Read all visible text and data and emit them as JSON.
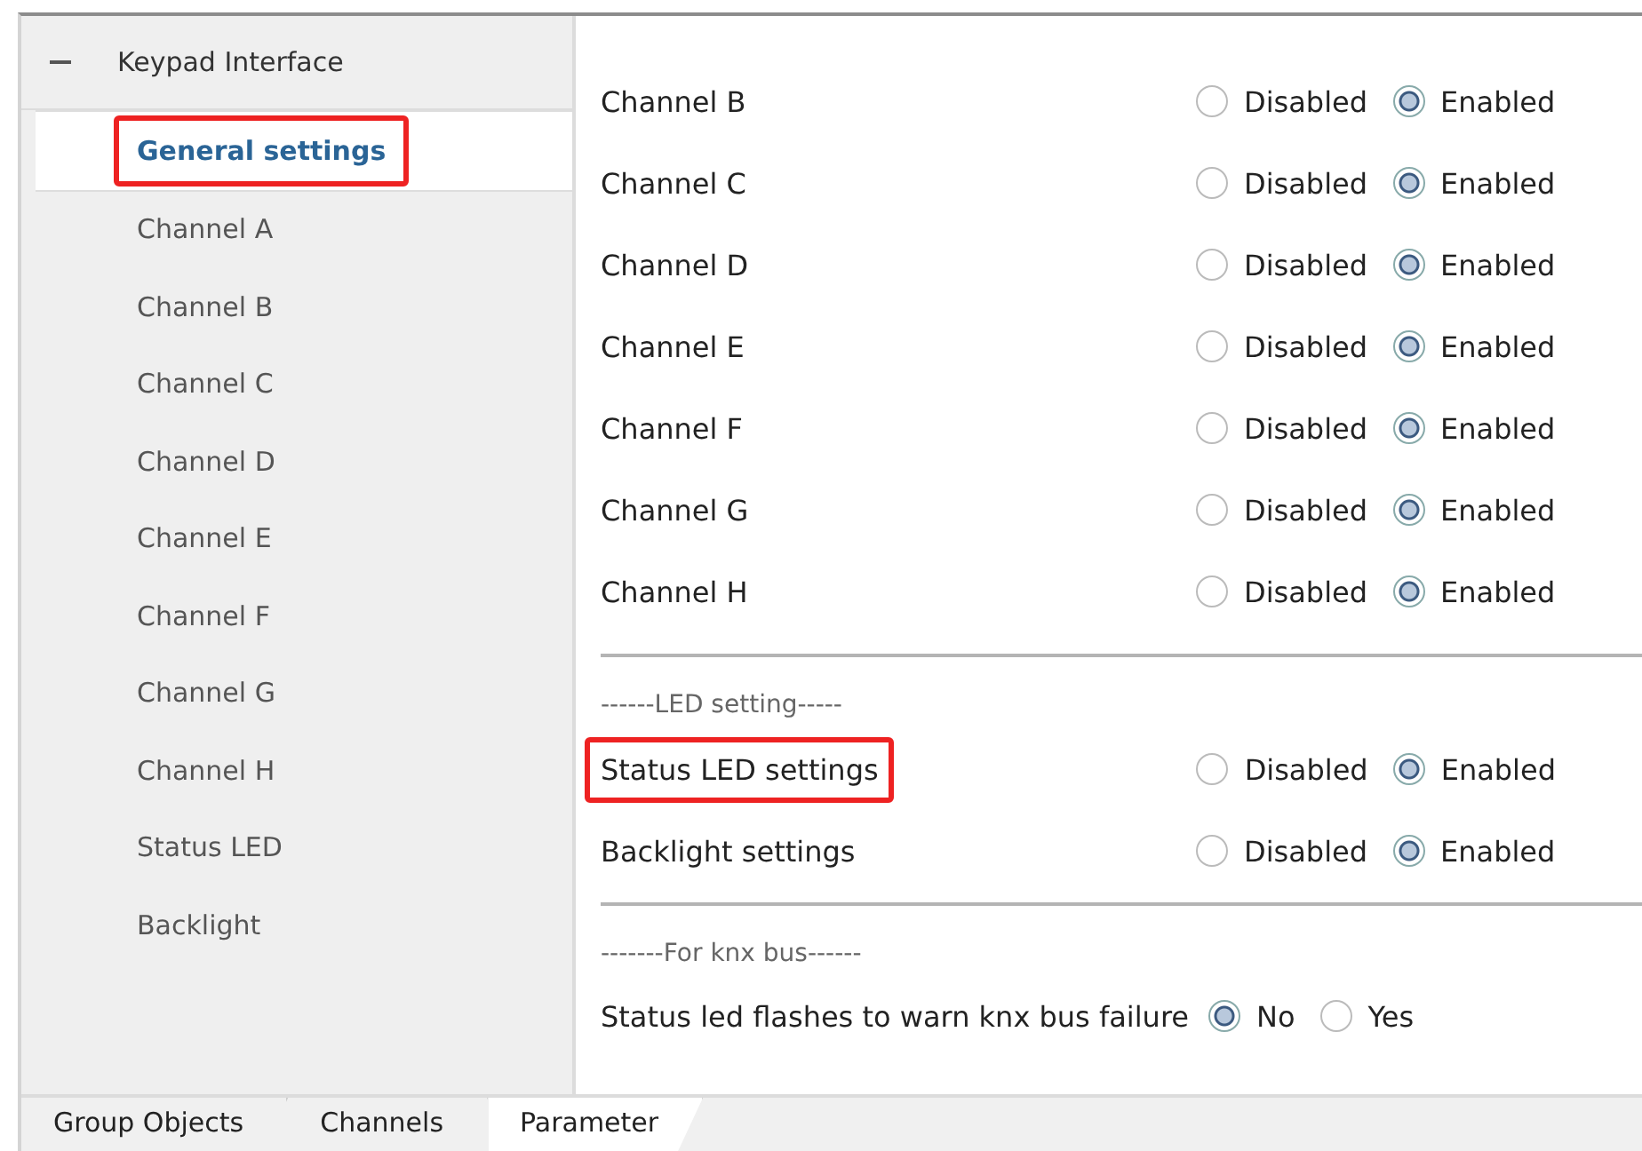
{
  "tree": {
    "title": "Keypad Interface",
    "expanded": true,
    "items": [
      {
        "label": "General settings",
        "selected": true,
        "highlighted": true
      },
      {
        "label": "Channel A",
        "selected": false,
        "highlighted": false
      },
      {
        "label": "Channel B",
        "selected": false,
        "highlighted": false
      },
      {
        "label": "Channel C",
        "selected": false,
        "highlighted": false
      },
      {
        "label": "Channel D",
        "selected": false,
        "highlighted": false
      },
      {
        "label": "Channel E",
        "selected": false,
        "highlighted": false
      },
      {
        "label": "Channel F",
        "selected": false,
        "highlighted": false
      },
      {
        "label": "Channel G",
        "selected": false,
        "highlighted": false
      },
      {
        "label": "Channel H",
        "selected": false,
        "highlighted": false
      },
      {
        "label": "Status LED",
        "selected": false,
        "highlighted": false
      },
      {
        "label": "Backlight",
        "selected": false,
        "highlighted": false
      }
    ]
  },
  "sections": [
    {
      "rows": [
        {
          "label": "Channel B",
          "highlighted": false,
          "options": [
            {
              "label": "Disabled",
              "selected": false
            },
            {
              "label": "Enabled",
              "selected": true
            }
          ]
        },
        {
          "label": "Channel C",
          "highlighted": false,
          "options": [
            {
              "label": "Disabled",
              "selected": false
            },
            {
              "label": "Enabled",
              "selected": true
            }
          ]
        },
        {
          "label": "Channel D",
          "highlighted": false,
          "options": [
            {
              "label": "Disabled",
              "selected": false
            },
            {
              "label": "Enabled",
              "selected": true
            }
          ]
        },
        {
          "label": "Channel E",
          "highlighted": false,
          "options": [
            {
              "label": "Disabled",
              "selected": false
            },
            {
              "label": "Enabled",
              "selected": true
            }
          ]
        },
        {
          "label": "Channel F",
          "highlighted": false,
          "options": [
            {
              "label": "Disabled",
              "selected": false
            },
            {
              "label": "Enabled",
              "selected": true
            }
          ]
        },
        {
          "label": "Channel G",
          "highlighted": false,
          "options": [
            {
              "label": "Disabled",
              "selected": false
            },
            {
              "label": "Enabled",
              "selected": true
            }
          ]
        },
        {
          "label": "Channel H",
          "highlighted": false,
          "options": [
            {
              "label": "Disabled",
              "selected": false
            },
            {
              "label": "Enabled",
              "selected": true
            }
          ]
        }
      ]
    },
    {
      "heading": "------LED setting-----",
      "rows": [
        {
          "label": "Status LED settings",
          "highlighted": true,
          "options": [
            {
              "label": "Disabled",
              "selected": false
            },
            {
              "label": "Enabled",
              "selected": true
            }
          ]
        },
        {
          "label": "Backlight settings",
          "highlighted": false,
          "options": [
            {
              "label": "Disabled",
              "selected": false
            },
            {
              "label": "Enabled",
              "selected": true
            }
          ]
        }
      ]
    },
    {
      "heading": "-------For knx bus------",
      "rows": [
        {
          "label": "Status led flashes to warn knx bus failure",
          "highlighted": false,
          "options": [
            {
              "label": "No",
              "selected": true
            },
            {
              "label": "Yes",
              "selected": false
            }
          ]
        }
      ]
    }
  ],
  "tabs": [
    {
      "label": "Group Objects",
      "selected": false
    },
    {
      "label": "Channels",
      "selected": false
    },
    {
      "label": "Parameter",
      "selected": true
    }
  ]
}
